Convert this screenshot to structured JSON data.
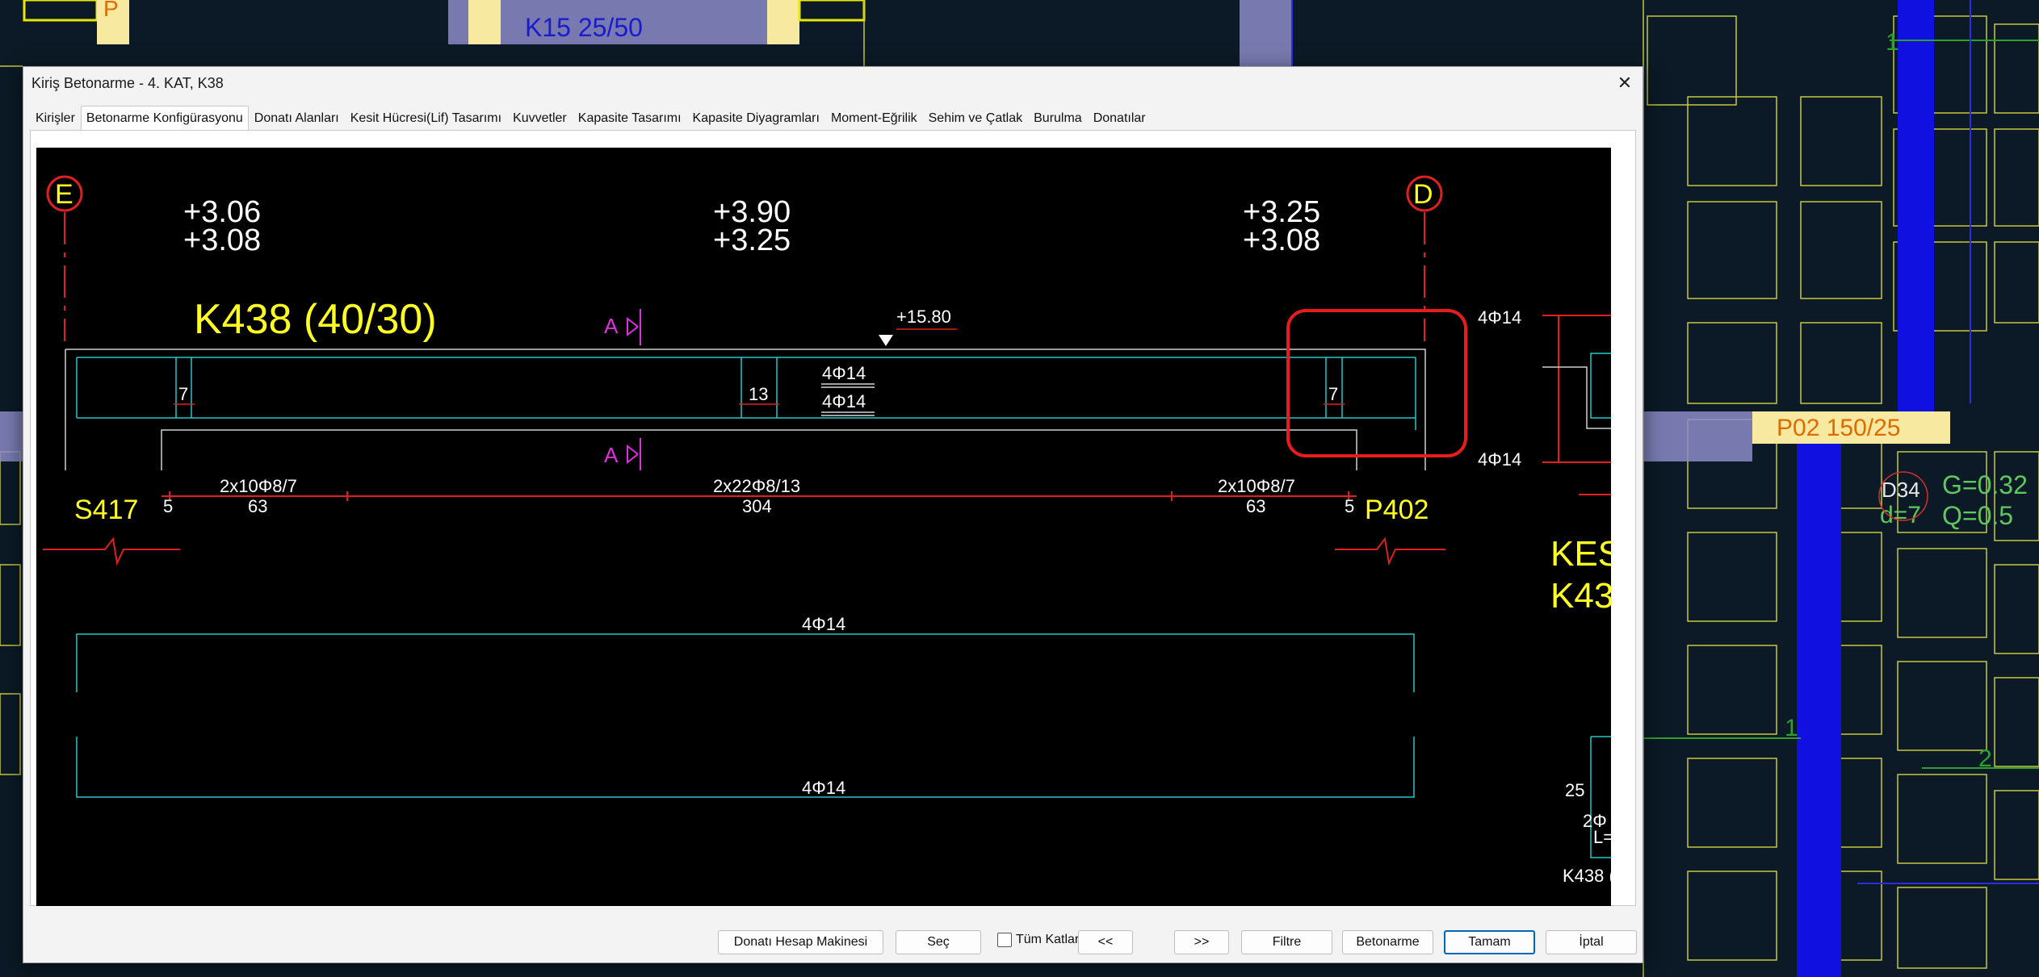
{
  "background": {
    "labels": {
      "top_beam": "K15   25/50",
      "p_label": "P",
      "p02": "P02 150/25",
      "d34": "D34",
      "g_val": "G=0.32",
      "d7": "d=7",
      "q_val": "Q=0.5",
      "n1": "1",
      "n1b": "1",
      "n2": "2"
    }
  },
  "dialog": {
    "title": "Kiriş Betonarme - 4. KAT, K38",
    "tabs": [
      {
        "label": "Kirişler"
      },
      {
        "label": "Betonarme Konfigürasyonu"
      },
      {
        "label": "Donatı Alanları"
      },
      {
        "label": "Kesit Hücresi(Lif) Tasarımı"
      },
      {
        "label": "Kuvvetler"
      },
      {
        "label": "Kapasite Tasarımı"
      },
      {
        "label": "Kapasite Diyagramları"
      },
      {
        "label": "Moment-Eğrilik"
      },
      {
        "label": "Sehim ve Çatlak"
      },
      {
        "label": "Burulma"
      },
      {
        "label": "Donatılar"
      }
    ],
    "active_tab": "Betonarme Konfigürasyonu"
  },
  "drawing": {
    "axis_left": "E",
    "axis_right": "D",
    "elev_left_1": "+3.06",
    "elev_left_2": "+3.08",
    "elev_mid_1": "+3.90",
    "elev_mid_2": "+3.25",
    "elev_right_1": "+3.25",
    "elev_right_2": "+3.08",
    "beam_title": "K438 (40/30)",
    "section_mark": "A",
    "level": "+15.80",
    "top_bars": "4Φ14",
    "bottom_bars": "4Φ14",
    "rebar_right_top": "4Φ14",
    "rebar_right_bottom": "4Φ14",
    "spacing_left": "7",
    "spacing_mid": "13",
    "spacing_right": "7",
    "stirrup_left": "2x10Φ8/7",
    "stirrup_left_len": "63",
    "stirrup_mid": "2x22Φ8/13",
    "stirrup_mid_len": "304",
    "stirrup_right": "2x10Φ8/7",
    "stirrup_right_len": "63",
    "offset_left": "5",
    "offset_right": "5",
    "support_left": "S417",
    "support_right": "P402",
    "kes_1": "KES",
    "kes_2": "K43",
    "long_top": "4Φ14",
    "long_bottom": "4Φ14",
    "sec_25": "25",
    "sec_2phi": "2Φ",
    "sec_L": "L=",
    "sec_name": "K438 ("
  },
  "buttons": {
    "calc": "Donatı Hesap Makinesi",
    "select": "Seç",
    "all_floors": "Tüm Katlar",
    "prev": "<<",
    "next": ">>",
    "filter": "Filtre",
    "concrete": "Betonarme",
    "ok": "Tamam",
    "cancel": "İptal"
  }
}
